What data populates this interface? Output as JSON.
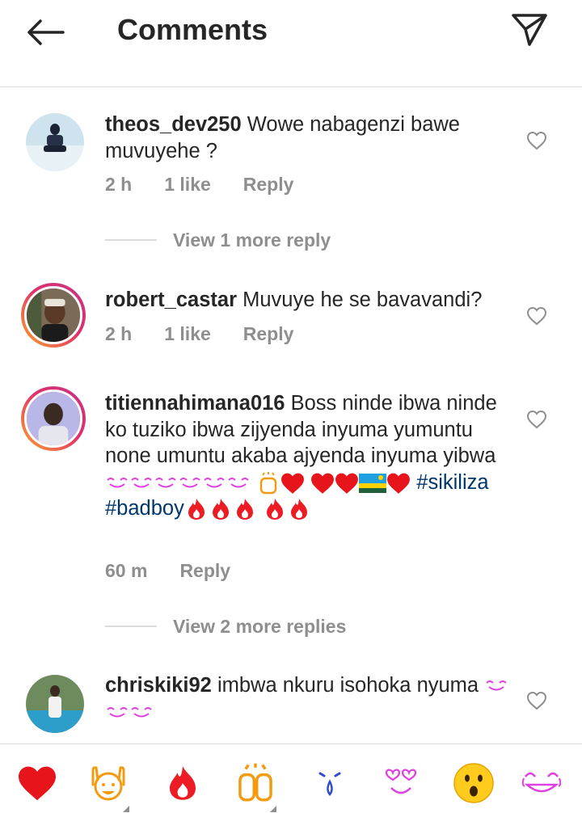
{
  "header": {
    "title": "Comments"
  },
  "comments": [
    {
      "username": "theos_dev250",
      "text": "Wowe nabagenzi bawe muvuyehe ?",
      "time": "2 h",
      "likes": "1 like",
      "reply": "Reply",
      "view_more": "View 1 more reply"
    },
    {
      "username": "robert_castar",
      "text": "Muvuye he se bavavandi?",
      "time": "2 h",
      "likes": "1 like",
      "reply": "Reply"
    },
    {
      "username": "titiennahimana016",
      "text": "Boss ninde ibwa ninde ko tuziko ibwa zijyenda inyuma yumuntu none umuntu akaba ajyenda inyuma yibwa",
      "hashtag1": "#sikiliza",
      "hashtag2": "#badboy",
      "time": "60 m",
      "reply": "Reply",
      "view_more": "View 2 more replies"
    },
    {
      "username": "chriskiki92",
      "text": "imbwa nkuru isohoka nyuma"
    }
  ],
  "emoji_bar": [
    "red-heart",
    "raising-hands",
    "fire",
    "clapping-hands",
    "crying-face",
    "heart-eyes",
    "astonished-face",
    "tears-of-joy"
  ],
  "colors": {
    "text": "#262626",
    "secondary": "#8e8e8e",
    "hashtag": "#00376b",
    "divider": "#dbdbdb",
    "heart": "#ed1c24"
  }
}
